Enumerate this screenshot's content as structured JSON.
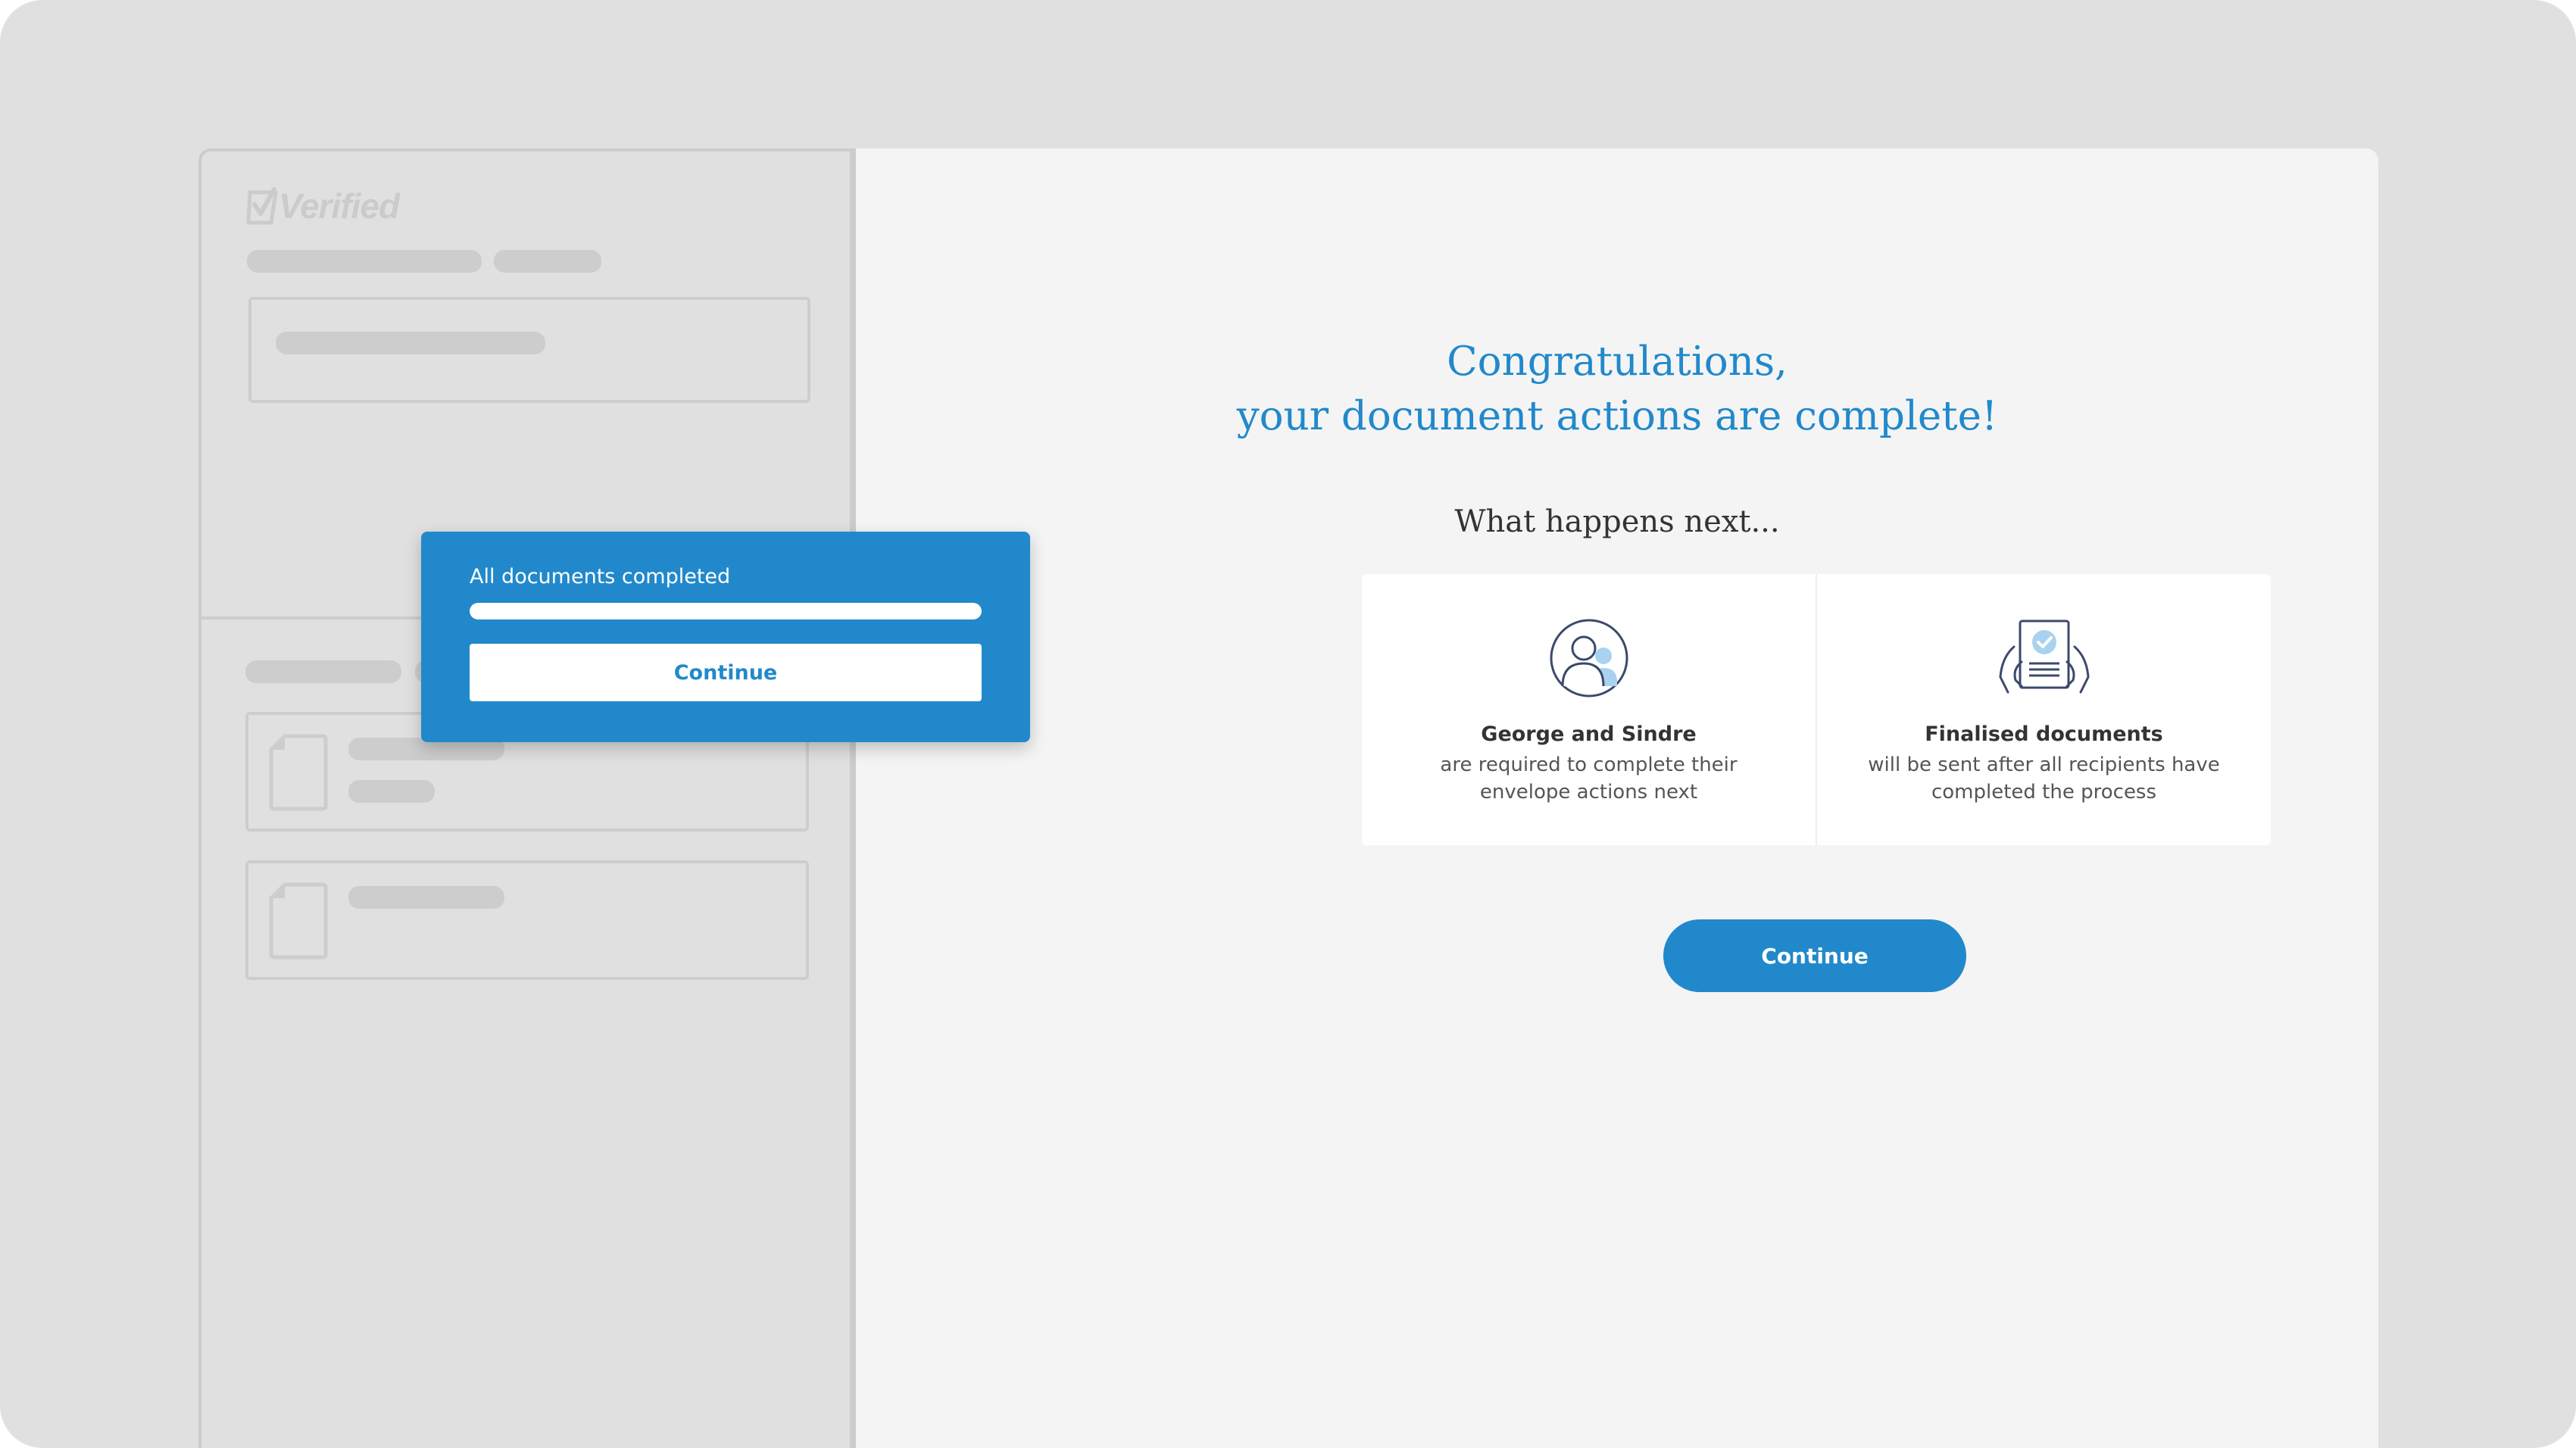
{
  "brand": {
    "logo_text": "Verified"
  },
  "popup": {
    "title": "All documents completed",
    "progress": 1.0,
    "button_label": "Continue"
  },
  "main": {
    "headline_line1": "Congratulations,",
    "headline_line2": "your document actions are complete!",
    "subheading": "What happens next...",
    "cards": [
      {
        "icon": "users-icon",
        "title": "George and Sindre",
        "description": "are required to complete their envelope actions next"
      },
      {
        "icon": "document-check-icon",
        "title": "Finalised documents",
        "description": "will be sent after all recipients have completed the process"
      }
    ],
    "continue_label": "Continue"
  },
  "colors": {
    "accent": "#2189cb",
    "background": "#e0e0e0",
    "panel": "#f4f4f4",
    "skeleton": "#cdcdcd"
  }
}
